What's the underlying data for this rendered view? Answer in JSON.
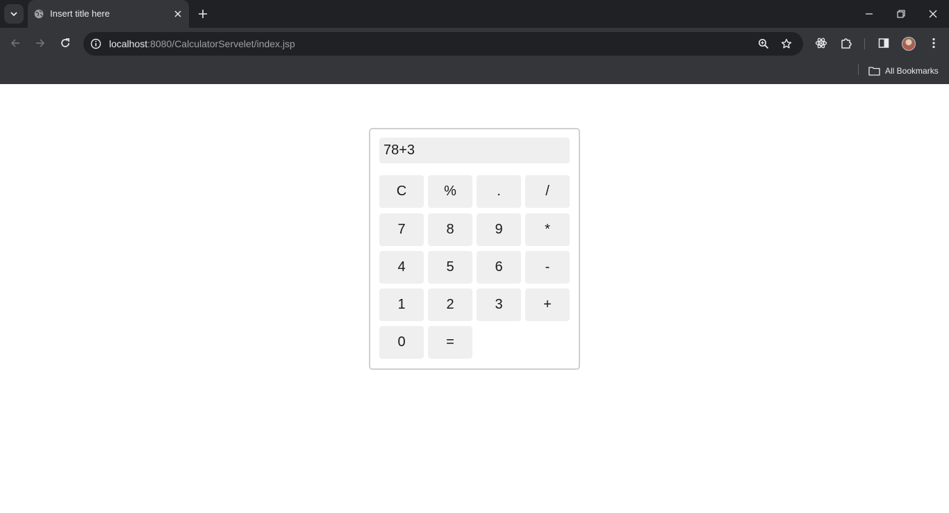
{
  "browser": {
    "tab": {
      "title": "Insert title here",
      "icon": "globe-icon"
    },
    "url": {
      "host": "localhost",
      "rest": ":8080/CalculatorServelet/index.jsp"
    },
    "bookmarks": {
      "all_label": "All Bookmarks"
    }
  },
  "calculator": {
    "display_value": "78+3",
    "keys": {
      "clear": "C",
      "percent": "%",
      "dot": ".",
      "divide": "/",
      "seven": "7",
      "eight": "8",
      "nine": "9",
      "multiply": "*",
      "four": "4",
      "five": "5",
      "six": "6",
      "minus": "-",
      "one": "1",
      "two": "2",
      "three": "3",
      "plus": "+",
      "zero": "0",
      "equals": "="
    }
  },
  "colors": {
    "chrome_dark": "#202124",
    "chrome_mid": "#35363a",
    "key_bg": "#efefef"
  }
}
